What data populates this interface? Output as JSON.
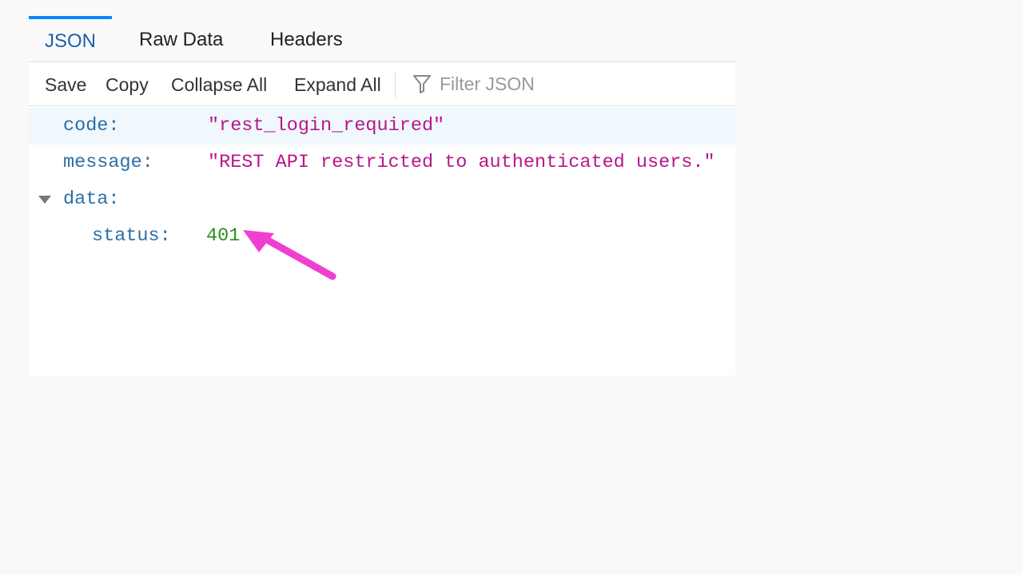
{
  "tabs": [
    {
      "label": "JSON",
      "active": true
    },
    {
      "label": "Raw Data"
    },
    {
      "label": "Headers"
    }
  ],
  "toolbar": {
    "save": "Save",
    "copy": "Copy",
    "collapse_all": "Collapse All",
    "expand_all": "Expand All",
    "filter_placeholder": "Filter JSON"
  },
  "json": {
    "code": {
      "key": "code:",
      "value": "\"rest_login_required\""
    },
    "message": {
      "key": "message:",
      "value": "\"REST API restricted to authenticated users.\""
    },
    "data": {
      "key": "data:",
      "expanded": true
    },
    "status": {
      "key": "status:",
      "value": "401"
    }
  },
  "colors": {
    "accent": "#0a84ff",
    "key": "#2b6fa6",
    "string": "#b8168a",
    "number": "#2c8a1c",
    "annotation_arrow": "#f03fd0"
  }
}
